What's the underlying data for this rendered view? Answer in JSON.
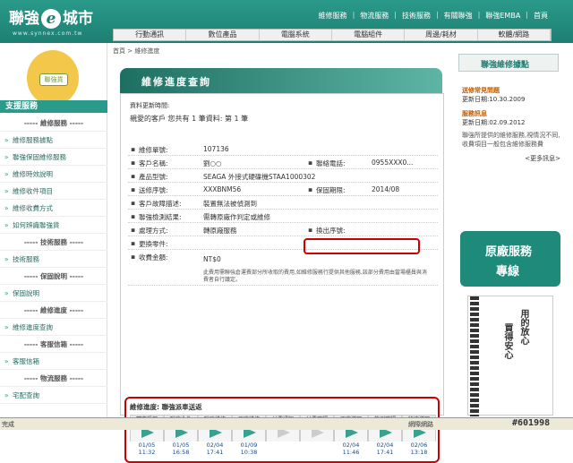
{
  "header": {
    "brand": "聯強",
    "brand_e": "e",
    "brand_suffix": "城市",
    "url": "www.synnex.com.tw",
    "topnav": [
      "維修服務",
      "物流服務",
      "技術服務",
      "有關聯強",
      "聯強EMBA",
      "首頁"
    ],
    "mainnav": [
      "行動通訊",
      "數位產品",
      "電腦系統",
      "電腦組件",
      "周邊/耗材",
      "軟體/網路"
    ]
  },
  "left": {
    "badge": "聯強貨",
    "support_title": "支援服務",
    "nav": [
      {
        "type": "head",
        "label": "----- 維修服務 -----"
      },
      {
        "type": "item",
        "label": "維修服務據點"
      },
      {
        "type": "item",
        "label": "聯強保固維修服務"
      },
      {
        "type": "item",
        "label": "維修時效說明"
      },
      {
        "type": "item",
        "label": "維修收件項目"
      },
      {
        "type": "item",
        "label": "維修收費方式"
      },
      {
        "type": "item",
        "label": "如何辨識聯強貨"
      },
      {
        "type": "head",
        "label": "----- 技術服務 -----"
      },
      {
        "type": "item",
        "label": "技術服務"
      },
      {
        "type": "head",
        "label": "----- 保固說明 -----"
      },
      {
        "type": "item",
        "label": "保固說明"
      },
      {
        "type": "head",
        "label": "----- 維修進度 -----"
      },
      {
        "type": "item",
        "label": "維修進度查詢"
      },
      {
        "type": "head",
        "label": "----- 客服信箱 -----"
      },
      {
        "type": "item",
        "label": "客服信箱"
      },
      {
        "type": "head",
        "label": "----- 物流服務 -----"
      },
      {
        "type": "item",
        "label": "宅配查詢"
      }
    ]
  },
  "main": {
    "breadcrumb": "首頁 > 維修進度",
    "title": "維修進度查詢",
    "meta1": "資料更新時間:",
    "meta2": "親愛的客戶 您共有 1 筆資料:    第  1  筆",
    "rows": [
      {
        "label": "維修單號:",
        "value": "107136"
      },
      {
        "label": "客戶名稱:",
        "value": "劉○○",
        "label2": "聯絡電話:",
        "value2": "0955XXX0..."
      },
      {
        "label": "產品型號:",
        "value": "SEAGA 外接式硬碟機STAA1000302"
      },
      {
        "label": "送修序號:",
        "value": "XXXBNM56",
        "label2": "保固期限:",
        "value2": "2014/08"
      },
      {
        "label": "客戶故障描述:",
        "value": "裝置無法被偵測到"
      },
      {
        "label": "聯強檢測結果:",
        "value": "需轉原廠作判定或維修"
      },
      {
        "label": "處理方式:",
        "value": "轉原廠服務",
        "label2": "換出序號:",
        "value2": ""
      },
      {
        "label": "更換零件:",
        "value": ""
      }
    ],
    "fee_label": "收費金額:",
    "fee_value": "NT$0",
    "fee_note": "此費用需聯強倉運費部分所收取的費用,如維修服務行提供其他服務,該部分費用由當場櫃員與消費者自行議定。",
    "progress_title": "維修進度: 聯強派車送返",
    "steps": [
      {
        "name": "門市受理",
        "date": "01/05",
        "time": "11:32",
        "on": true
      },
      {
        "name": "聯強收件",
        "date": "01/05",
        "time": "16:58",
        "on": true
      },
      {
        "name": "聯強維修",
        "date": "02/04",
        "time": "17:41",
        "on": true
      },
      {
        "name": "原廠維修",
        "date": "01/09",
        "time": "10:38",
        "on": true
      },
      {
        "name": "付費通知",
        "date": "",
        "time": "",
        "on": false
      },
      {
        "name": "付費確認",
        "date": "",
        "time": "",
        "on": false
      },
      {
        "name": "原廠送回",
        "date": "02/04",
        "time": "11:46",
        "on": true
      },
      {
        "name": "檢測確認",
        "date": "02/04",
        "time": "17:41",
        "on": true
      },
      {
        "name": "物流送回",
        "date": "02/06",
        "time": "13:18",
        "on": true
      }
    ]
  },
  "right": {
    "head": "聯強維修據點",
    "faq_title": "送修常見問題",
    "faq_date": "更新日期:10.30.2009",
    "news_title": "服務訊息",
    "news_date": "更新日期:02.09.2012",
    "news_text": "聯強所提供的維修服務,視情況不同,收費項目一般包含維修服務費",
    "more": "<更多訊息>",
    "service_line1": "原廠服務",
    "service_line2": "專線",
    "ad1": "買得安心",
    "ad2": "用的放心"
  },
  "status": {
    "left": "完成",
    "zone": "網際網路",
    "stamp": "#601998"
  }
}
